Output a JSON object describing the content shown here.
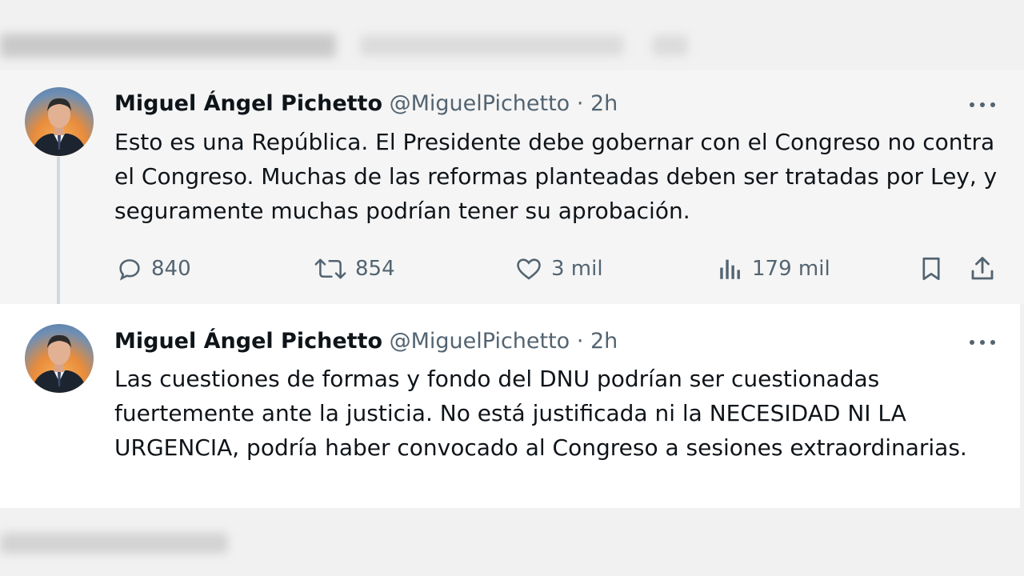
{
  "colors": {
    "text_primary": "#0f1419",
    "text_secondary": "#536471",
    "thread_line": "#cfd9de",
    "tweet1_bg": "#f5f5f5",
    "tweet2_bg": "#ffffff"
  },
  "tweets": [
    {
      "author_name": "Miguel Ángel Pichetto",
      "handle": "@MiguelPichetto",
      "separator": "·",
      "time": "2h",
      "text": "Esto es una República. El Presidente debe gobernar con el Congreso no contra el Congreso. Muchas de las reformas planteadas deben ser tratadas por Ley, y seguramente muchas podrían tener su aprobación.",
      "actions": {
        "replies": "840",
        "reposts": "854",
        "likes": "3 mil",
        "views": "179 mil"
      },
      "icons": [
        "reply-icon",
        "repost-icon",
        "like-icon",
        "views-icon",
        "bookmark-icon",
        "share-icon",
        "more-icon"
      ]
    },
    {
      "author_name": "Miguel Ángel Pichetto",
      "handle": "@MiguelPichetto",
      "separator": "·",
      "time": "2h",
      "text": "Las cuestiones de formas y fondo del DNU podrían ser cuestionadas fuertemente ante la justicia. No está justificada ni la NECESIDAD NI LA URGENCIA, podría haber convocado al Congreso a sesiones extraordinarias.",
      "icons": [
        "more-icon"
      ]
    }
  ]
}
